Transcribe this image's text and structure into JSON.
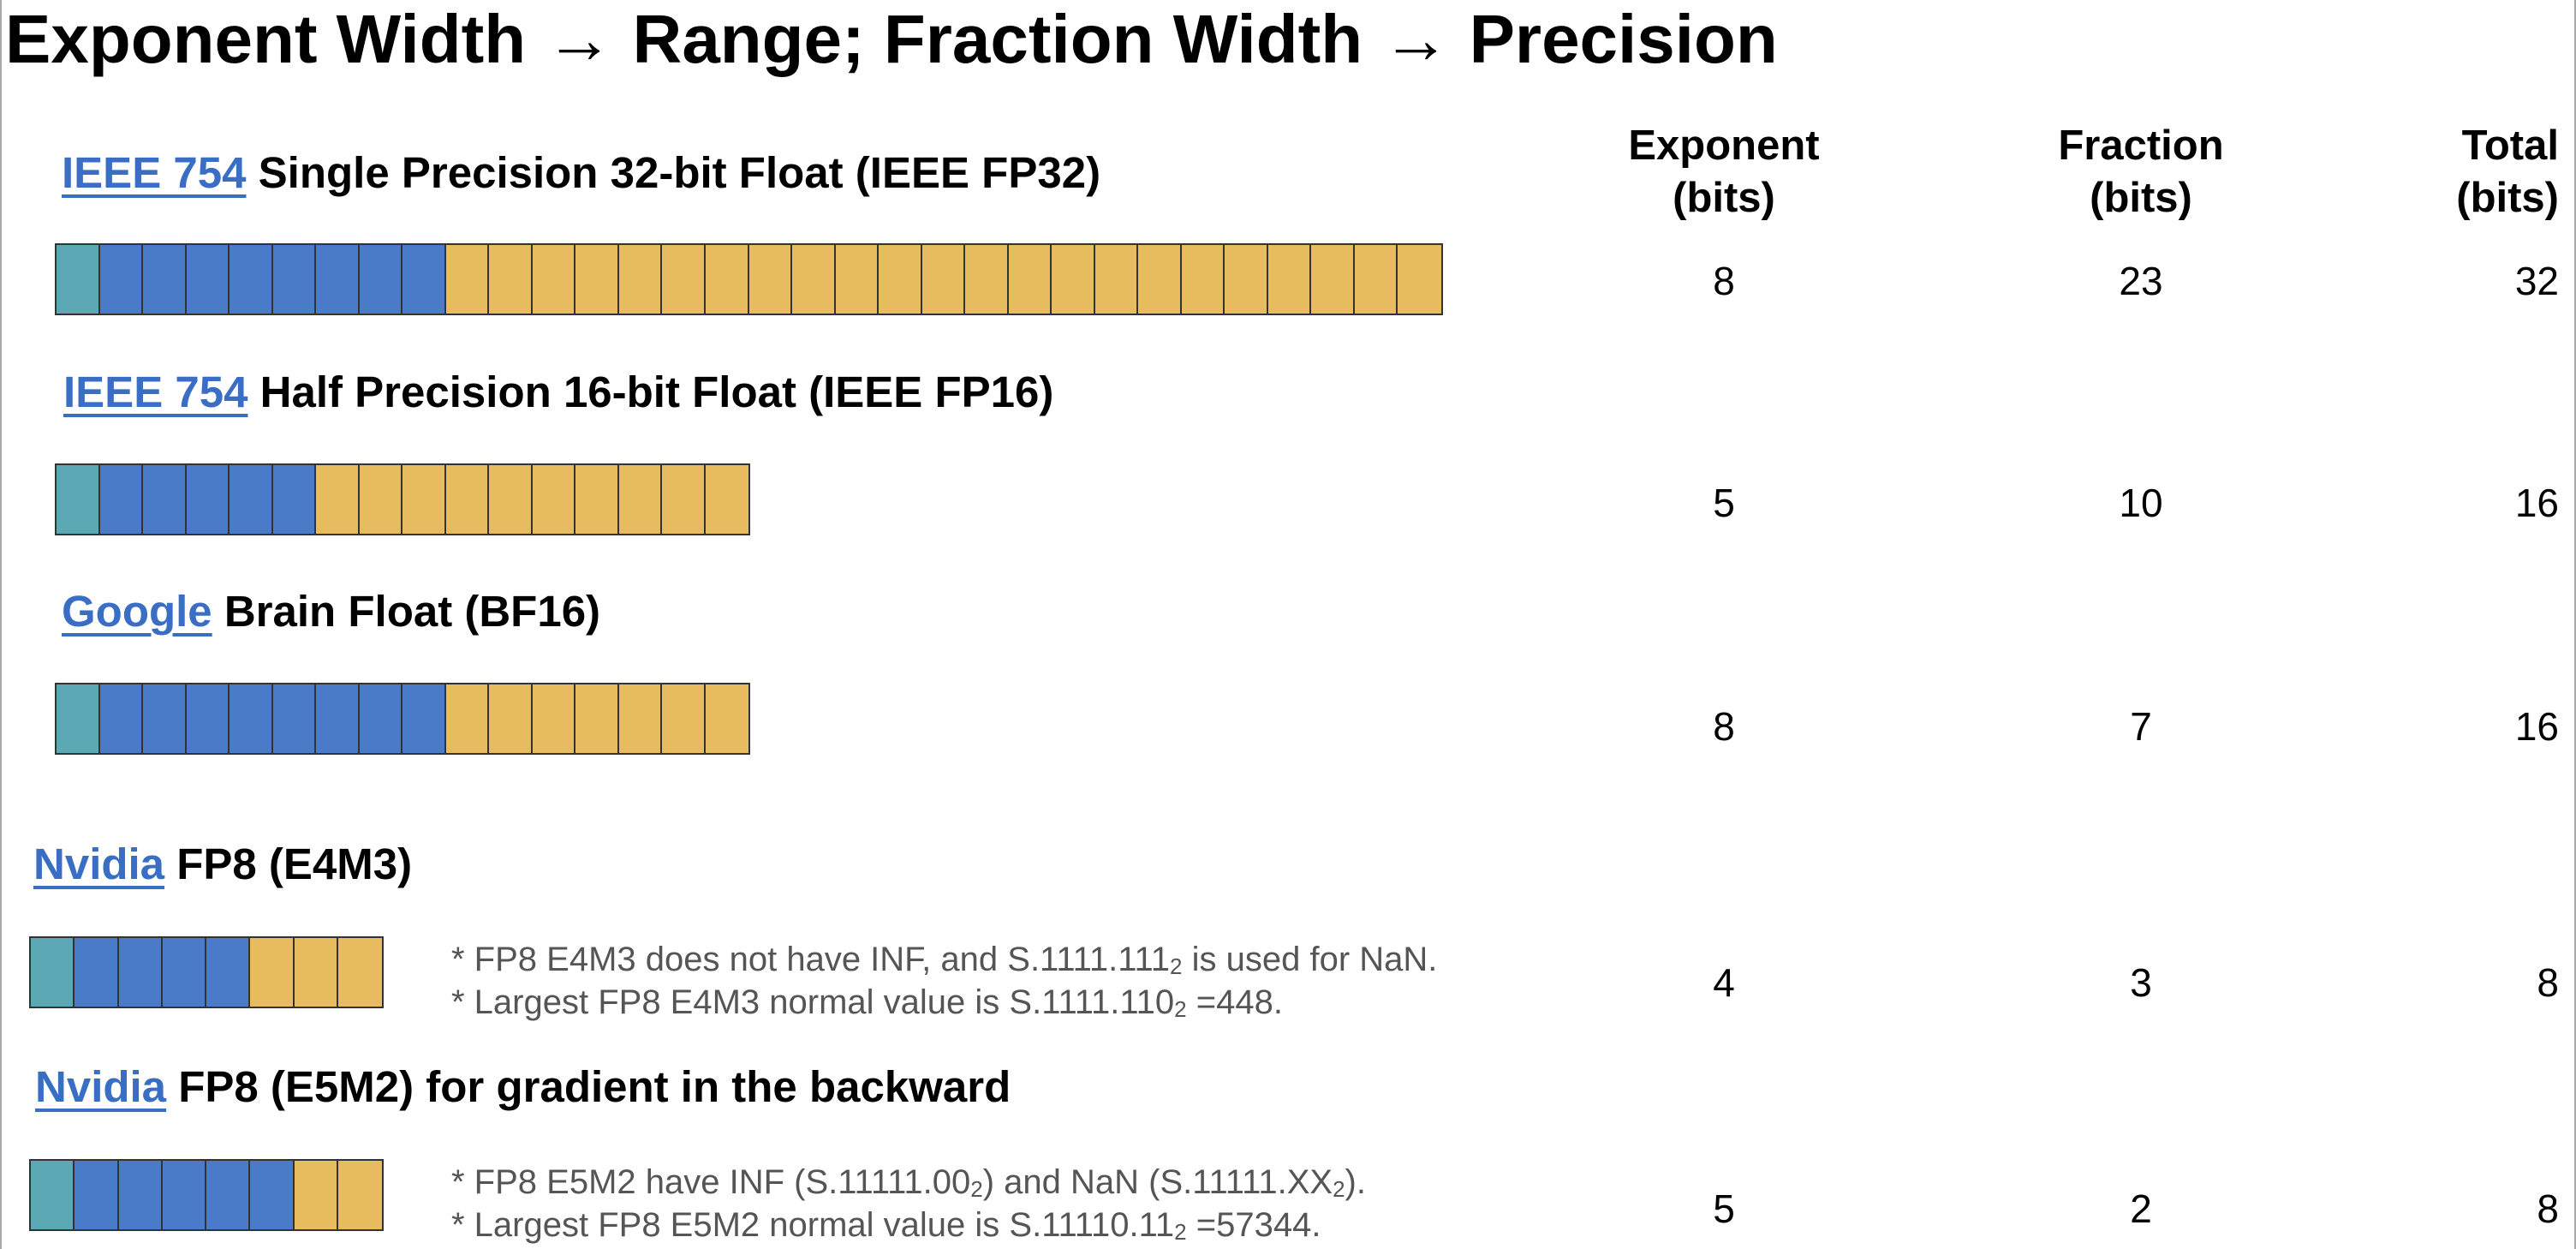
{
  "title": "Exponent Width → Range; Fraction Width → Precision",
  "columns": {
    "exponent": "Exponent\n(bits)",
    "fraction": "Fraction\n(bits)",
    "total": "Total\n(bits)"
  },
  "colors": {
    "sign": "#5ca8b5",
    "exponent": "#4a7bc8",
    "fraction": "#e7bc5e",
    "link": "#3a6ec4"
  },
  "formats": [
    {
      "vendor": "IEEE 754",
      "name": " Single Precision 32-bit Float (IEEE FP32)",
      "exponent_bits": "8",
      "fraction_bits": "23",
      "total_bits": "32",
      "sign": 1,
      "exp": 8,
      "frac": 23
    },
    {
      "vendor": "IEEE 754",
      "name": " Half Precision 16-bit Float (IEEE FP16)",
      "exponent_bits": "5",
      "fraction_bits": "10",
      "total_bits": "16",
      "sign": 1,
      "exp": 5,
      "frac": 10
    },
    {
      "vendor": "Google",
      "name": " Brain Float (BF16)",
      "exponent_bits": "8",
      "fraction_bits": "7",
      "total_bits": "16",
      "sign": 1,
      "exp": 8,
      "frac": 7
    },
    {
      "vendor": "Nvidia",
      "name": " FP8 (E4M3)",
      "exponent_bits": "4",
      "fraction_bits": "3",
      "total_bits": "8",
      "sign": 1,
      "exp": 4,
      "frac": 3,
      "notes": [
        {
          "pre": "* FP8 E4M3 does not have INF, and S.1111.111",
          "sub": "2",
          "post": " is used for NaN."
        },
        {
          "pre": "* Largest FP8 E4M3 normal value is S.1111.110",
          "sub": "2",
          "post": " =448."
        }
      ]
    },
    {
      "vendor": "Nvidia",
      "name": " FP8 (E5M2) for gradient in the backward",
      "exponent_bits": "5",
      "fraction_bits": "2",
      "total_bits": "8",
      "sign": 1,
      "exp": 5,
      "frac": 2,
      "notes": [
        {
          "pre": "* FP8 E5M2 have INF (S.11111.00",
          "sub": "2",
          "post": ") and NaN (S.11111.XX",
          "sub2": "2",
          "post2": ")."
        },
        {
          "pre": "* Largest FP8 E5M2 normal value is S.11110.11",
          "sub": "2",
          "post": " =57344."
        }
      ]
    }
  ]
}
